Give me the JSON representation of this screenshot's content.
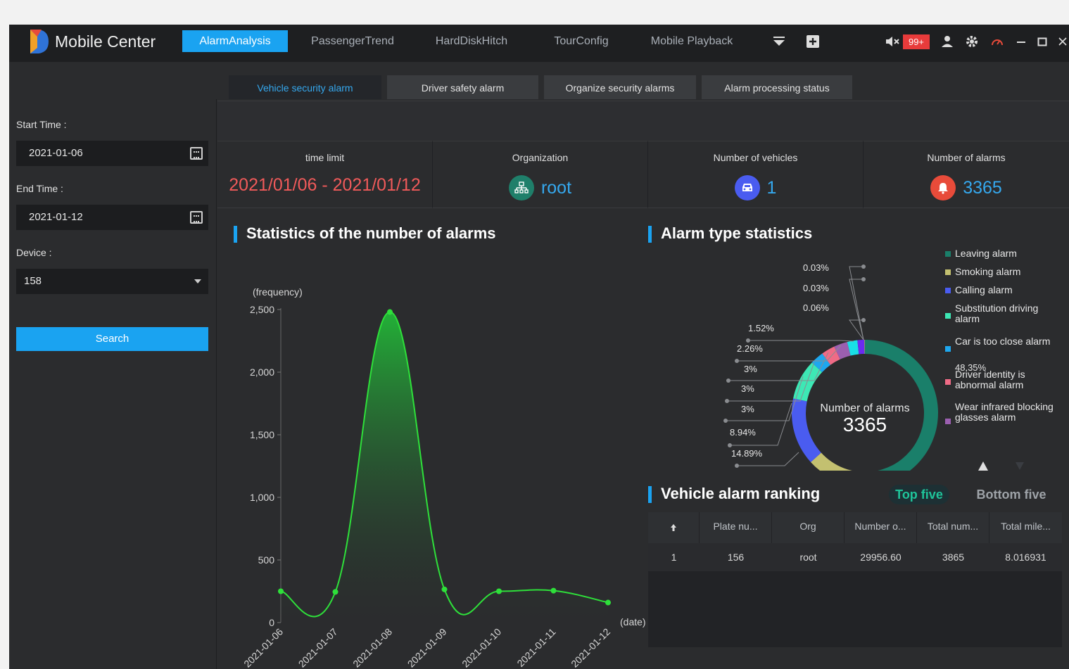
{
  "app": {
    "title": "Mobile Center"
  },
  "nav": {
    "tabs": [
      "AlarmAnalysis",
      "PassengerTrend",
      "HardDiskHitch",
      "TourConfig",
      "Mobile Playback"
    ],
    "active": "AlarmAnalysis",
    "badge": "99+"
  },
  "subtabs": [
    "Vehicle security alarm",
    "Driver safety alarm",
    "Organize security alarms",
    "Alarm processing status"
  ],
  "sidebar": {
    "start_label": "Start Time :",
    "start_value": "2021-01-06",
    "end_label": "End Time :",
    "end_value": "2021-01-12",
    "device_label": "Device :",
    "device_value": "158",
    "search_label": "Search"
  },
  "stats": {
    "time_limit_label": "time limit",
    "time_limit_value": "2021/01/06 - 2021/01/12",
    "org_label": "Organization",
    "org_value": "root",
    "vehicles_label": "Number of vehicles",
    "vehicles_value": "1",
    "alarms_label": "Number of alarms",
    "alarms_value": "3365"
  },
  "colors": {
    "accent": "#1aa3f1",
    "time_limit": "#f05a5a",
    "value": "#35a8ee",
    "line": "#2ee03a"
  },
  "line_section": {
    "title": "Statistics of the number of alarms"
  },
  "donut_section": {
    "title": "Alarm type statistics",
    "center_label": "Number of alarms",
    "center_value": "3365"
  },
  "ranking": {
    "title": "Vehicle alarm ranking",
    "top_five": "Top five",
    "bottom_five": "Bottom five",
    "columns": [
      "Plate nu...",
      "Org",
      "Number o...",
      "Total num...",
      "Total mile..."
    ],
    "rows": [
      [
        "1",
        "156",
        "root",
        "29956.60",
        "3865",
        "8.016931"
      ]
    ]
  },
  "chart_data": [
    {
      "type": "area",
      "ylabel": "(frequency)",
      "xlabel": "(date)",
      "categories": [
        "2021-01-06",
        "2021-01-07",
        "2021-01-08",
        "2021-01-09",
        "2021-01-10",
        "2021-01-11",
        "2021-01-12"
      ],
      "values": [
        250,
        245,
        2480,
        265,
        250,
        255,
        160
      ],
      "ylim": [
        0,
        2500
      ],
      "yticks": [
        "0",
        "500",
        "1,000",
        "1,500",
        "2,000",
        "2,500"
      ]
    },
    {
      "type": "pie",
      "center_label": "Number of alarms",
      "total": "3365",
      "legend": [
        {
          "name": "Leaving alarm",
          "color": "#1a7f6a"
        },
        {
          "name": "Smoking alarm",
          "color": "#c3c070"
        },
        {
          "name": "Calling alarm",
          "color": "#4a5cf0"
        },
        {
          "name": "Substitution driving alarm",
          "color": "#3de8b5"
        },
        {
          "name": "Car is too close alarm",
          "color": "#1ea7ee"
        },
        {
          "name": "Driver identity is abnormal alarm",
          "color": "#ef6b86"
        },
        {
          "name": "Wear infrared blocking glasses alarm",
          "color": "#9b5fb0"
        }
      ],
      "slices": [
        {
          "value": 48.35,
          "color": "#1a7f6a"
        },
        {
          "value": 14.89,
          "color": "#c3c070"
        },
        {
          "value": 14.89,
          "color": "#4a5cf0"
        },
        {
          "value": 8.94,
          "color": "#3de8b5"
        },
        {
          "value": 3,
          "color": "#1ea7ee"
        },
        {
          "value": 3,
          "color": "#ef6b86"
        },
        {
          "value": 3,
          "color": "#9b5fb0"
        },
        {
          "value": 2.26,
          "color": "#19dfe6"
        },
        {
          "value": 1.52,
          "color": "#6a2cf0"
        },
        {
          "value": 0.06,
          "color": "#f0a030"
        },
        {
          "value": 0.03,
          "color": "#e0e0e0"
        },
        {
          "value": 0.03,
          "color": "#a0e0a0"
        }
      ],
      "labels": [
        "0.03%",
        "0.03%",
        "0.06%",
        "1.52%",
        "2.26%",
        "3%",
        "3%",
        "3%",
        "8.94%",
        "14.89%",
        "14.89%",
        "48.35%"
      ]
    }
  ]
}
